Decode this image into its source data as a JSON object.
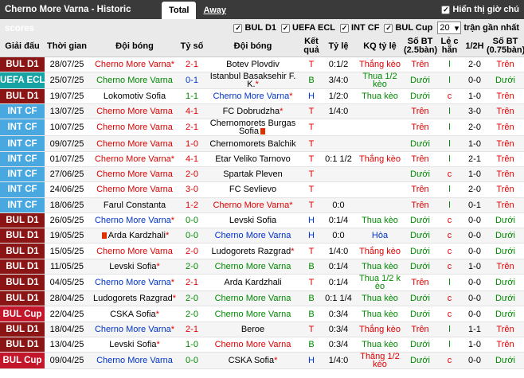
{
  "header": {
    "title": "Cherno More Varna - Historic scores",
    "tab_total": "Total",
    "tab_away": "Away",
    "half_label": "Hiển thị giờ chú"
  },
  "filters": {
    "items": [
      "BUL D1",
      "UEFA ECL",
      "INT CF",
      "BUL Cup"
    ],
    "count": "20",
    "count_suffix": "trận gần nhất"
  },
  "columns": [
    "Giải đấu",
    "Thời gian",
    "Đội bóng",
    "Tỷ số",
    "Đội bóng",
    "Kết quả",
    "Tỷ lệ",
    "KQ tỷ lệ",
    "Số BT (2.5bàn)",
    "Lẻ c hẵn",
    "1/2H",
    "Số BT (0.75bàn)"
  ],
  "colors": {
    "BUL D1": "#8b1414",
    "UEFA ECL": "#16a3a3",
    "INT CF": "#4aa8e0",
    "BUL Cup": "#c4162a",
    "home_team": "#e00000",
    "away_team": "#008a00",
    "cherno": "#0033cc"
  },
  "rows": [
    {
      "comp": "BUL D1",
      "date": "28/07/25",
      "home": "Cherno More Varna",
      "home_star": true,
      "score": "2-1",
      "away": "Botev Plovdiv",
      "res": "T",
      "odds": "0:1/2",
      "ores": "Thắng kèo",
      "ou": "Trên",
      "oe": "l",
      "ht": "2-0",
      "ou2": "Trên",
      "home_c": "red",
      "away_c": "",
      "score_c": "red",
      "res_c": "red",
      "ores_c": "red",
      "ou_c": "red",
      "oe_c": "green",
      "ou2_c": "red"
    },
    {
      "comp": "UEFA ECL",
      "date": "25/07/25",
      "home": "Cherno More Varna",
      "home_star": false,
      "score": "0-1",
      "away": "Istanbul Basaksehir F. K.",
      "away_star": true,
      "res": "B",
      "odds": "3/4:0",
      "ores": "Thua 1/2 kèo",
      "ou": "Dưới",
      "oe": "l",
      "ht": "0-0",
      "ou2": "Dưới",
      "home_c": "green",
      "away_c": "",
      "score_c": "blue",
      "res_c": "green",
      "ores_c": "green",
      "ou_c": "green",
      "oe_c": "green",
      "ou2_c": "green"
    },
    {
      "comp": "BUL D1",
      "date": "19/07/25",
      "home": "Lokomotiv Sofia",
      "score": "1-1",
      "away": "Cherno More Varna",
      "away_star": true,
      "res": "H",
      "odds": "1/2:0",
      "ores": "Thua kèo",
      "ou": "Dưới",
      "oe": "c",
      "ht": "1-0",
      "ou2": "Trên",
      "home_c": "",
      "away_c": "blue",
      "score_c": "green",
      "res_c": "blue",
      "ores_c": "green",
      "ou_c": "green",
      "oe_c": "red",
      "ou2_c": "red"
    },
    {
      "comp": "INT CF",
      "date": "13/07/25",
      "home": "Cherno More Varna",
      "score": "4-1",
      "away": "FC Dobrudzha",
      "away_star": true,
      "res": "T",
      "odds": "1/4:0",
      "ores": "",
      "ou": "Trên",
      "oe": "l",
      "ht": "3-0",
      "ou2": "Trên",
      "home_c": "red",
      "away_c": "",
      "score_c": "red",
      "res_c": "red",
      "ores_c": "",
      "ou_c": "red",
      "oe_c": "green",
      "ou2_c": "red"
    },
    {
      "comp": "INT CF",
      "date": "10/07/25",
      "home": "Cherno More Varna",
      "score": "2-1",
      "away": "Chernomorets Burgas Sofia",
      "away_card": true,
      "res": "T",
      "odds": "",
      "ores": "",
      "ou": "Trên",
      "oe": "l",
      "ht": "2-0",
      "ou2": "Trên",
      "home_c": "red",
      "away_c": "",
      "score_c": "red",
      "res_c": "red",
      "ores_c": "",
      "ou_c": "red",
      "oe_c": "green",
      "ou2_c": "red"
    },
    {
      "comp": "INT CF",
      "date": "09/07/25",
      "home": "Cherno More Varna",
      "score": "1-0",
      "away": "Chernomorets Balchik",
      "res": "T",
      "odds": "",
      "ores": "",
      "ou": "Dưới",
      "oe": "l",
      "ht": "1-0",
      "ou2": "Trên",
      "home_c": "red",
      "away_c": "",
      "score_c": "red",
      "res_c": "red",
      "ores_c": "",
      "ou_c": "green",
      "oe_c": "green",
      "ou2_c": "red"
    },
    {
      "comp": "INT CF",
      "date": "01/07/25",
      "home": "Cherno More Varna",
      "home_star": true,
      "score": "4-1",
      "away": "Etar Veliko Tarnovo",
      "res": "T",
      "odds": "0:1 1/2",
      "ores": "Thắng kèo",
      "ou": "Trên",
      "oe": "l",
      "ht": "2-1",
      "ou2": "Trên",
      "home_c": "red",
      "away_c": "",
      "score_c": "red",
      "res_c": "red",
      "ores_c": "red",
      "ou_c": "red",
      "oe_c": "green",
      "ou2_c": "red"
    },
    {
      "comp": "INT CF",
      "date": "27/06/25",
      "home": "Cherno More Varna",
      "score": "2-0",
      "away": "Spartak Pleven",
      "res": "T",
      "odds": "",
      "ores": "",
      "ou": "Dưới",
      "oe": "c",
      "ht": "1-0",
      "ou2": "Trên",
      "home_c": "red",
      "away_c": "",
      "score_c": "red",
      "res_c": "red",
      "ores_c": "",
      "ou_c": "green",
      "oe_c": "red",
      "ou2_c": "red"
    },
    {
      "comp": "INT CF",
      "date": "24/06/25",
      "home": "Cherno More Varna",
      "score": "3-0",
      "away": "FC Sevlievo",
      "res": "T",
      "odds": "",
      "ores": "",
      "ou": "Trên",
      "oe": "l",
      "ht": "2-0",
      "ou2": "Trên",
      "home_c": "red",
      "away_c": "",
      "score_c": "red",
      "res_c": "red",
      "ores_c": "",
      "ou_c": "red",
      "oe_c": "green",
      "ou2_c": "red"
    },
    {
      "comp": "INT CF",
      "date": "18/06/25",
      "home": "Farul Constanta",
      "score": "1-2",
      "away": "Cherno More Varna",
      "away_star": true,
      "res": "T",
      "odds": "0:0",
      "ores": "",
      "ou": "Trên",
      "oe": "l",
      "ht": "0-1",
      "ou2": "Trên",
      "home_c": "",
      "away_c": "red",
      "score_c": "red",
      "res_c": "red",
      "ores_c": "",
      "ou_c": "red",
      "oe_c": "green",
      "ou2_c": "red"
    },
    {
      "comp": "BUL D1",
      "date": "26/05/25",
      "home": "Cherno More Varna",
      "home_star": true,
      "score": "0-0",
      "away": "Levski Sofia",
      "res": "H",
      "odds": "0:1/4",
      "ores": "Thua kèo",
      "ou": "Dưới",
      "oe": "c",
      "ht": "0-0",
      "ou2": "Dưới",
      "home_c": "blue",
      "away_c": "",
      "score_c": "green",
      "res_c": "blue",
      "ores_c": "green",
      "ou_c": "green",
      "oe_c": "red",
      "ou2_c": "green"
    },
    {
      "comp": "BUL D1",
      "date": "19/05/25",
      "home": "Arda Kardzhali",
      "home_card": true,
      "home_star": true,
      "score": "0-0",
      "away": "Cherno More Varna",
      "res": "H",
      "odds": "0:0",
      "ores": "Hòa",
      "ou": "Dưới",
      "oe": "c",
      "ht": "0-0",
      "ou2": "Dưới",
      "home_c": "",
      "away_c": "blue",
      "score_c": "green",
      "res_c": "blue",
      "ores_c": "blue",
      "ou_c": "green",
      "oe_c": "red",
      "ou2_c": "green"
    },
    {
      "comp": "BUL D1",
      "date": "15/05/25",
      "home": "Cherno More Varna",
      "score": "2-0",
      "away": "Ludogorets Razgrad",
      "away_star": true,
      "res": "T",
      "odds": "1/4:0",
      "ores": "Thắng kèo",
      "ou": "Dưới",
      "oe": "c",
      "ht": "0-0",
      "ou2": "Dưới",
      "home_c": "red",
      "away_c": "",
      "score_c": "red",
      "res_c": "red",
      "ores_c": "red",
      "ou_c": "green",
      "oe_c": "red",
      "ou2_c": "green"
    },
    {
      "comp": "BUL D1",
      "date": "11/05/25",
      "home": "Levski Sofia",
      "home_star": true,
      "score": "2-0",
      "away": "Cherno More Varna",
      "res": "B",
      "odds": "0:1/4",
      "ores": "Thua kèo",
      "ou": "Dưới",
      "oe": "c",
      "ht": "1-0",
      "ou2": "Trên",
      "home_c": "",
      "away_c": "green",
      "score_c": "green",
      "res_c": "green",
      "ores_c": "green",
      "ou_c": "green",
      "oe_c": "red",
      "ou2_c": "red"
    },
    {
      "comp": "BUL D1",
      "date": "04/05/25",
      "home": "Cherno More Varna",
      "home_star": true,
      "score": "2-1",
      "away": "Arda Kardzhali",
      "res": "T",
      "odds": "0:1/4",
      "ores": "Thua 1/2 k èo",
      "ou": "Trên",
      "oe": "l",
      "ht": "0-0",
      "ou2": "Dưới",
      "home_c": "blue",
      "away_c": "",
      "score_c": "red",
      "res_c": "red",
      "ores_c": "green",
      "ou_c": "red",
      "oe_c": "green",
      "ou2_c": "green"
    },
    {
      "comp": "BUL D1",
      "date": "28/04/25",
      "home": "Ludogorets Razgrad",
      "home_star": true,
      "score": "2-0",
      "away": "Cherno More Varna",
      "res": "B",
      "odds": "0:1 1/4",
      "ores": "Thua kèo",
      "ou": "Dưới",
      "oe": "c",
      "ht": "0-0",
      "ou2": "Dưới",
      "home_c": "",
      "away_c": "green",
      "score_c": "green",
      "res_c": "green",
      "ores_c": "green",
      "ou_c": "green",
      "oe_c": "red",
      "ou2_c": "green"
    },
    {
      "comp": "BUL Cup",
      "date": "22/04/25",
      "home": "CSKA Sofia",
      "home_star": true,
      "score": "2-0",
      "away": "Cherno More Varna",
      "res": "B",
      "odds": "0:3/4",
      "ores": "Thua kèo",
      "ou": "Dưới",
      "oe": "c",
      "ht": "0-0",
      "ou2": "Dưới",
      "home_c": "",
      "away_c": "green",
      "score_c": "green",
      "res_c": "green",
      "ores_c": "green",
      "ou_c": "green",
      "oe_c": "red",
      "ou2_c": "green"
    },
    {
      "comp": "BUL D1",
      "date": "18/04/25",
      "home": "Cherno More Varna",
      "home_star": true,
      "score": "2-1",
      "away": "Beroe",
      "res": "T",
      "odds": "0:3/4",
      "ores": "Thắng kèo",
      "ou": "Trên",
      "oe": "l",
      "ht": "1-1",
      "ou2": "Trên",
      "home_c": "blue",
      "away_c": "",
      "score_c": "red",
      "res_c": "red",
      "ores_c": "red",
      "ou_c": "red",
      "oe_c": "green",
      "ou2_c": "red"
    },
    {
      "comp": "BUL D1",
      "date": "13/04/25",
      "home": "Levski Sofia",
      "home_star": true,
      "score": "1-0",
      "away": "Cherno More Varna",
      "res": "B",
      "odds": "0:3/4",
      "ores": "Thua kèo",
      "ou": "Dưới",
      "oe": "l",
      "ht": "1-0",
      "ou2": "Trên",
      "home_c": "",
      "away_c": "red",
      "score_c": "green",
      "res_c": "green",
      "ores_c": "green",
      "ou_c": "green",
      "oe_c": "green",
      "ou2_c": "red"
    },
    {
      "comp": "BUL Cup",
      "date": "09/04/25",
      "home": "Cherno More Varna",
      "score": "0-0",
      "away": "CSKA Sofia",
      "away_star": true,
      "res": "H",
      "odds": "1/4:0",
      "ores": "Thắng 1/2 kèo",
      "ou": "Dưới",
      "oe": "c",
      "ht": "0-0",
      "ou2": "Dưới",
      "home_c": "blue",
      "away_c": "",
      "score_c": "green",
      "res_c": "blue",
      "ores_c": "red",
      "ou_c": "green",
      "oe_c": "red",
      "ou2_c": "green"
    }
  ]
}
